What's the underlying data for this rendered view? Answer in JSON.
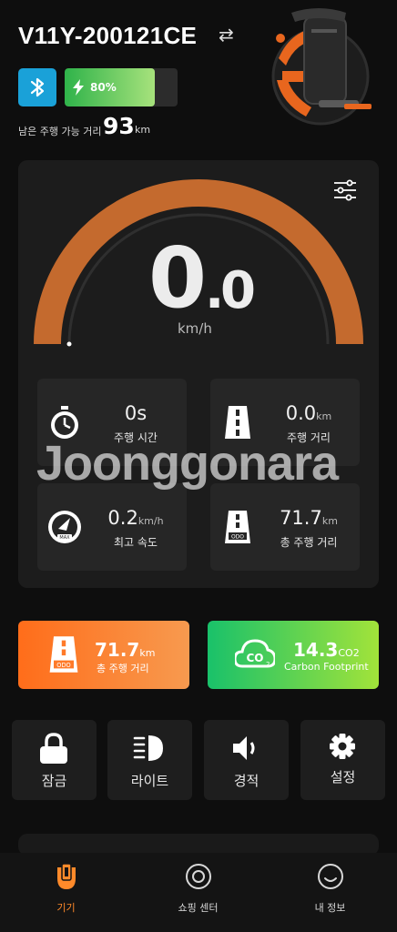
{
  "header": {
    "device_name": "V11Y-200121CE",
    "swap_icon": "⇄",
    "battery_percent": 80,
    "battery_label": "80%",
    "range_label": "남은 주행 가능 거리",
    "range_value": "93",
    "range_unit": "km"
  },
  "speedometer": {
    "speed_int": "0",
    "speed_dot": ".",
    "speed_dec": "0",
    "unit": "km/h",
    "gauge_level": 0
  },
  "stats": [
    {
      "value": "0s",
      "unit": "",
      "label": "주행 시간",
      "icon": "stopwatch-icon"
    },
    {
      "value": "0.0",
      "unit": "km",
      "label": "주행 거리",
      "icon": "road-icon"
    },
    {
      "value": "0.2",
      "unit": "km/h",
      "label": "최고 속도",
      "icon": "speedometer-max-icon"
    },
    {
      "value": "71.7",
      "unit": "km",
      "label": "총 주행 거리",
      "icon": "odometer-road-icon"
    }
  ],
  "watermark": "Joonggonara",
  "promo": {
    "odo": {
      "value": "71.7",
      "unit": "km",
      "label": "총 주행 거리"
    },
    "co2": {
      "value": "14.3",
      "unit": "CO2",
      "label": "Carbon Footprint"
    }
  },
  "controls": [
    {
      "label": "잠금",
      "icon": "lock-icon"
    },
    {
      "label": "라이트",
      "icon": "headlight-icon"
    },
    {
      "label": "경적",
      "icon": "speaker-icon"
    },
    {
      "label": "설정",
      "icon": "gear-icon"
    }
  ],
  "tabs": [
    {
      "label": "기기",
      "icon": "unicycle-icon",
      "active": true
    },
    {
      "label": "쇼핑 센터",
      "icon": "shop-icon",
      "active": false
    },
    {
      "label": "내 정보",
      "icon": "profile-icon",
      "active": false
    }
  ],
  "colors": {
    "accent": "#ff8a2a",
    "bluetooth": "#1aa1d8",
    "battery": "#6fce5f",
    "gauge_arc": "#c46a2e",
    "odo_gradient_start": "#ff6d1a",
    "co2_gradient_start": "#19c16a"
  }
}
